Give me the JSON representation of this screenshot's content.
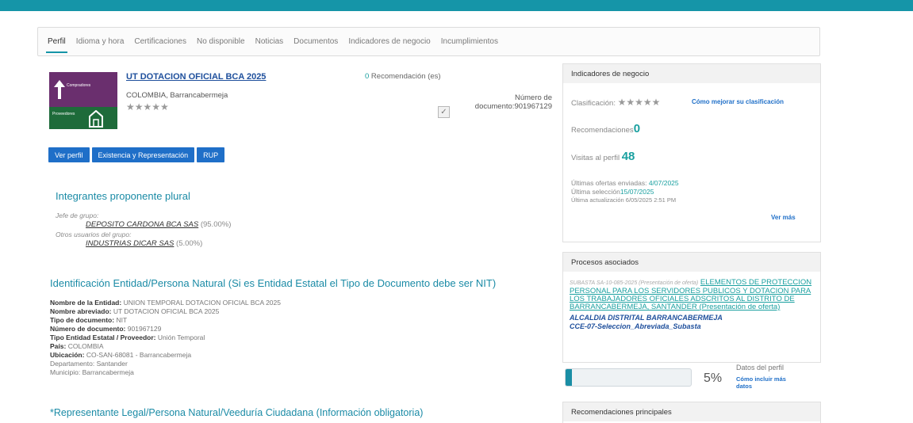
{
  "tabs": [
    {
      "label": "Perfil",
      "active": true
    },
    {
      "label": "Idioma y hora"
    },
    {
      "label": "Certificaciones"
    },
    {
      "label": "No disponible"
    },
    {
      "label": "Noticias"
    },
    {
      "label": "Documentos"
    },
    {
      "label": "Indicadores de negocio"
    },
    {
      "label": "Incumplimientos"
    }
  ],
  "profile": {
    "title": "UT DOTACION OFICIAL BCA 2025",
    "location": "COLOMBIA, Barrancabermeja",
    "stars": "★★★★★",
    "recommendations_count": "0",
    "recommendations_label": " Recomendación (es)",
    "doc_label": "Número de documento:",
    "doc_value": "901967129",
    "logo_top_label": "Compradores",
    "logo_bottom_label": "Proveedores"
  },
  "buttons": {
    "ver_perfil": "Ver perfil",
    "existencia": "Existencia y Representación",
    "rup": "RUP"
  },
  "integrantes": {
    "heading": "Integrantes proponente plural",
    "leader_label": "Jefe de grupo:",
    "leader_name": "DEPOSITO CARDONA BCA SAS",
    "leader_pct": " (95.00%)",
    "others_label": "Otros usuarios del grupo:",
    "other_name": "INDUSTRIAS DICAR SAS",
    "other_pct": " (5.00%)"
  },
  "identificacion": {
    "heading": "Identificación Entidad/Persona Natural (Si es Entidad Estatal el Tipo de Documento debe ser NIT)",
    "fields": [
      {
        "label": "Nombre de la Entidad:",
        "value": "UNION TEMPORAL DOTACION OFICIAL BCA 2025"
      },
      {
        "label": "Nombre abreviado:",
        "value": "UT DOTACION OFICIAL BCA 2025"
      },
      {
        "label": "Tipo de documento:",
        "value": "NIT"
      },
      {
        "label": "Número de documento:",
        "value": "901967129"
      },
      {
        "label": "Tipo Entidad Estatal / Proveedor:",
        "value": "Unión Temporal"
      },
      {
        "label": "País:",
        "value": "COLOMBIA"
      },
      {
        "label": "Ubicación:",
        "value": "CO-SAN-68081 - Barrancabermeja"
      },
      {
        "label": "",
        "value": "Departamento: Santander"
      },
      {
        "label": "",
        "value": "Municipio: Barrancabermeja"
      }
    ]
  },
  "representante_heading": "*Representante Legal/Persona Natural/Veeduría Ciudadana (Información obligatoria)",
  "indicadores": {
    "heading": "Indicadores de negocio",
    "clasificacion_label": "Clasificación:",
    "stars": "★★★★★",
    "mejorar_link": "Cómo mejorar su clasificación",
    "recomendaciones_label": "Recomendaciones",
    "recomendaciones_value": "0",
    "visitas_label": "Visitas al perfil",
    "visitas_value": "48",
    "ultimas_label": "Últimas ofertas enviadas:",
    "ultimas_value": "4/07/2025",
    "ultima_sel_label": "Última selección",
    "ultima_sel_value": "15/07/2025",
    "ultima_act": "Última actualización 6/05/2025 2:51 PM",
    "ver_mas": "Ver más"
  },
  "procesos": {
    "heading": "Procesos asociados",
    "meta": "SUBASTA SA-10-085-2025 (Presentación de oferta)",
    "title": "ELEMENTOS DE PROTECCION PERSONAL PARA LOS SERVIDORES PUBLICOS Y DOTACION PARA LOS TRABAJADORES OFICIALES ADSCRITOS AL DISTRITO DE BARRANCABERMEJA, SANTANDER (Presentación de oferta)",
    "entity": "ALCALDIA DISTRITAL BARRANCABERMEJA",
    "code": "CCE-07-Seleccion_Abreviada_Subasta"
  },
  "perfil_progress": {
    "percent_value": 5,
    "percent_text": "5%",
    "label": "Datos del perfil",
    "link": "Cómo incluir más datos"
  },
  "recomendaciones_principales": "Recomendaciones principales",
  "colors": {
    "accent": "#1595a8",
    "button": "#1f6fc8",
    "link": "#1b8ba6"
  }
}
